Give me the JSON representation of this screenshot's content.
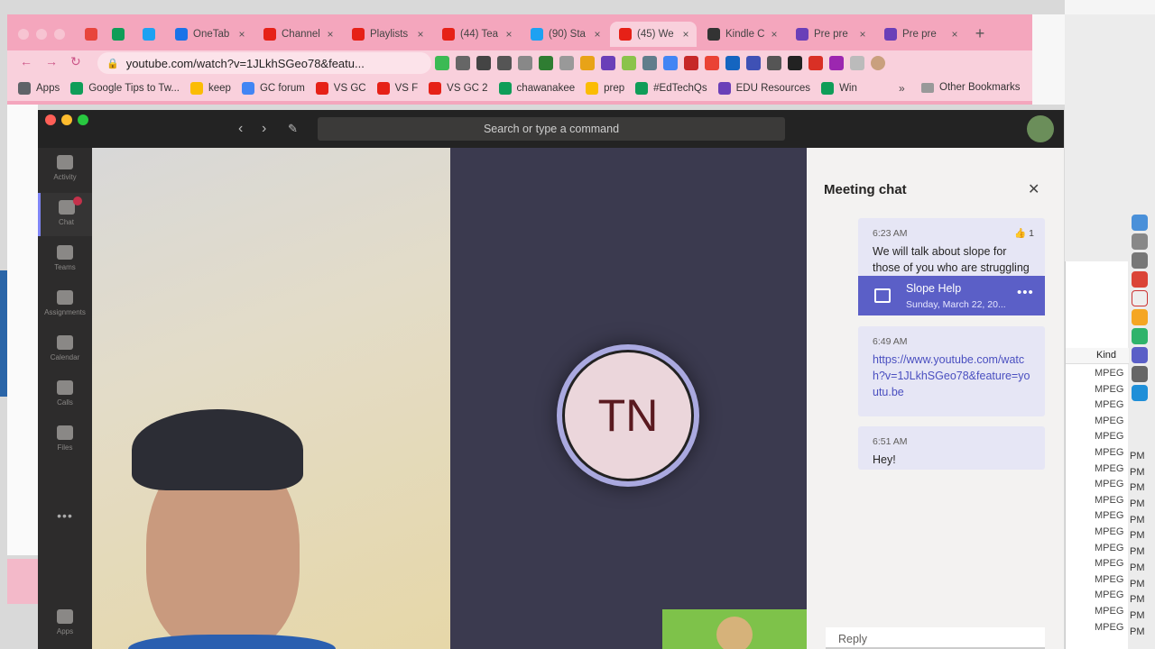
{
  "browser": {
    "tabs": [
      {
        "label": "",
        "color": "#e8453c"
      },
      {
        "label": "",
        "color": "#0f9d58"
      },
      {
        "label": "",
        "color": "#1da1f2"
      },
      {
        "label": "OneTab",
        "color": "#1a73e8"
      },
      {
        "label": "Channel",
        "color": "#e62117"
      },
      {
        "label": "Playlists",
        "color": "#e62117"
      },
      {
        "label": "(44) Tea",
        "color": "#e62117"
      },
      {
        "label": "(90) Sta",
        "color": "#1da1f2"
      },
      {
        "label": "(45) We",
        "color": "#e62117"
      },
      {
        "label": "Kindle C",
        "color": "#333333"
      },
      {
        "label": "Pre pre",
        "color": "#6a3fb8"
      },
      {
        "label": "Pre pre",
        "color": "#6a3fb8"
      }
    ],
    "close_glyph": "×",
    "new_tab_glyph": "+",
    "url": "youtube.com/watch?v=1JLkhSGeo78&featu...",
    "bookmarks": [
      {
        "label": "Apps",
        "color": "#5f6368"
      },
      {
        "label": "Google Tips to Tw...",
        "color": "#0f9d58"
      },
      {
        "label": "keep",
        "color": "#fbbc04"
      },
      {
        "label": "GC forum",
        "color": "#4285f4"
      },
      {
        "label": "VS GC",
        "color": "#e62117"
      },
      {
        "label": "VS F",
        "color": "#e62117"
      },
      {
        "label": "VS GC 2",
        "color": "#e62117"
      },
      {
        "label": "chawanakee",
        "color": "#0f9d58"
      },
      {
        "label": "prep",
        "color": "#fbbc04"
      },
      {
        "label": "#EdTechQs",
        "color": "#0f9d58"
      },
      {
        "label": "EDU Resources",
        "color": "#6a3fb8"
      },
      {
        "label": "Win",
        "color": "#0f9d58"
      }
    ],
    "bookmarks_overflow": "»",
    "other_bookmarks": "Other Bookmarks"
  },
  "teams": {
    "search_placeholder": "Search or type a command",
    "rail": [
      {
        "label": "Activity"
      },
      {
        "label": "Chat"
      },
      {
        "label": "Teams"
      },
      {
        "label": "Assignments"
      },
      {
        "label": "Calendar"
      },
      {
        "label": "Calls"
      },
      {
        "label": "Files"
      }
    ],
    "rail_more": "•••",
    "rail_apps": "Apps",
    "participant_initials": "TN",
    "chat": {
      "title": "Meeting chat",
      "close": "✕",
      "messages": [
        {
          "time": "6:23 AM",
          "text": "We will talk about slope for those of you who are struggling",
          "reaction": "👍 1"
        },
        {
          "time": "6:49 AM",
          "text": "https://www.youtube.com/watch?v=1JLkhSGeo78&feature=youtu.be"
        },
        {
          "time": "6:51 AM",
          "text": "Hey!"
        }
      ],
      "meeting_card": {
        "title": "Slope Help",
        "date": "Sunday, March 22, 20..."
      },
      "meeting_more": "•••",
      "reply_placeholder": "Reply"
    }
  },
  "background": {
    "kind_header": "Kind",
    "kind_rows": [
      "MPEG",
      "MPEG",
      "MPEG",
      "MPEG",
      "MPEG",
      "MPEG",
      "MPEG",
      "MPEG",
      "MPEG",
      "MPEG",
      "MPEG",
      "MPEG",
      "MPEG",
      "MPEG",
      "MPEG",
      "MPEG",
      "MPEG"
    ],
    "pm_rows": [
      "PM",
      "PM",
      "PM",
      "PM",
      "PM",
      "PM",
      "PM",
      "PM",
      "PM",
      "PM",
      "PM",
      "PM"
    ]
  }
}
